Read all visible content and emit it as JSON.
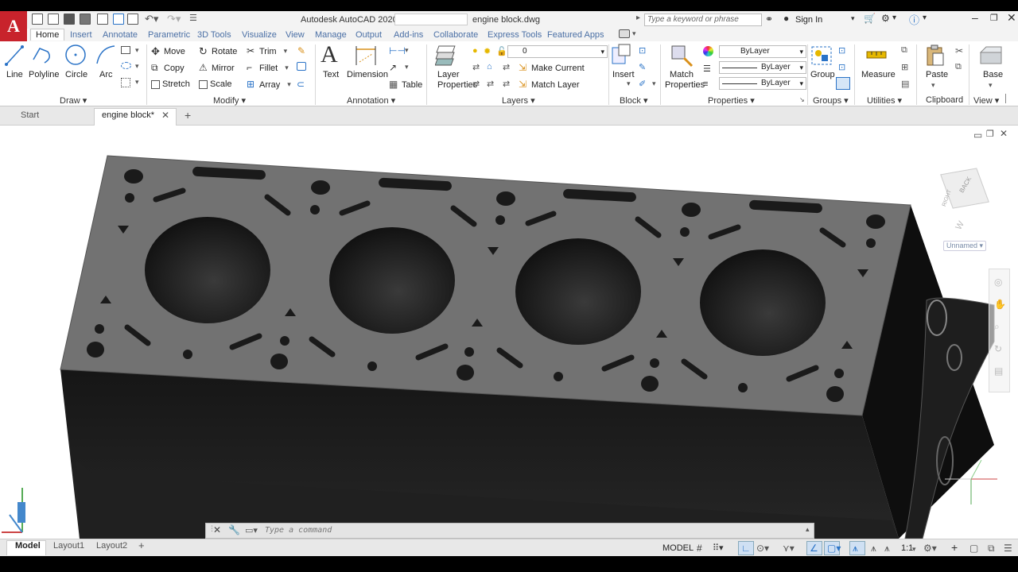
{
  "app": {
    "logo_letter": "A",
    "title_prefix": "Autodesk AutoCAD 2020 -",
    "document_name": "engine block.dwg",
    "search_placeholder": "Type a keyword or phrase",
    "sign_in": "Sign In"
  },
  "ribbon_tabs": [
    "Home",
    "Insert",
    "Annotate",
    "Parametric",
    "3D Tools",
    "Visualize",
    "View",
    "Manage",
    "Output",
    "Add-ins",
    "Collaborate",
    "Express Tools",
    "Featured Apps"
  ],
  "draw": {
    "label": "Draw",
    "line": "Line",
    "polyline": "Polyline",
    "circle": "Circle",
    "arc": "Arc"
  },
  "modify": {
    "label": "Modify",
    "move": "Move",
    "rotate": "Rotate",
    "trim": "Trim",
    "copy": "Copy",
    "mirror": "Mirror",
    "fillet": "Fillet",
    "stretch": "Stretch",
    "scale": "Scale",
    "array": "Array"
  },
  "annotation": {
    "label": "Annotation",
    "text": "Text",
    "dimension": "Dimension",
    "table": "Table"
  },
  "layers": {
    "label": "Layers",
    "layer_properties": "Layer Properties",
    "current_layer": "0",
    "make_current": "Make Current",
    "match_layer": "Match Layer"
  },
  "block": {
    "label": "Block",
    "insert": "Insert"
  },
  "properties": {
    "label": "Properties",
    "match_properties": "Match Properties",
    "color": "ByLayer",
    "linetype": "ByLayer",
    "lineweight": "ByLayer"
  },
  "groups": {
    "label": "Groups",
    "group": "Group"
  },
  "utilities": {
    "label": "Utilities",
    "measure": "Measure"
  },
  "clipboard": {
    "label": "Clipboard",
    "paste": "Paste"
  },
  "view": {
    "label": "View",
    "base": "Base"
  },
  "doc_tabs": {
    "start": "Start",
    "active": "engine block*"
  },
  "viewcube": {
    "face": "BACK",
    "side": "RIGHT",
    "compass": "W",
    "named_view": "Unnamed"
  },
  "command": {
    "placeholder": "Type a command"
  },
  "layout_tabs": [
    "Model",
    "Layout1",
    "Layout2"
  ],
  "status": {
    "model": "MODEL",
    "scale": "1:1"
  },
  "colors": {
    "accent": "#c8232c",
    "block_top": "#737373",
    "block_side": "#1c1c1c",
    "ribbon_bg": "#ffffff",
    "chrome": "#f3f3f3"
  }
}
